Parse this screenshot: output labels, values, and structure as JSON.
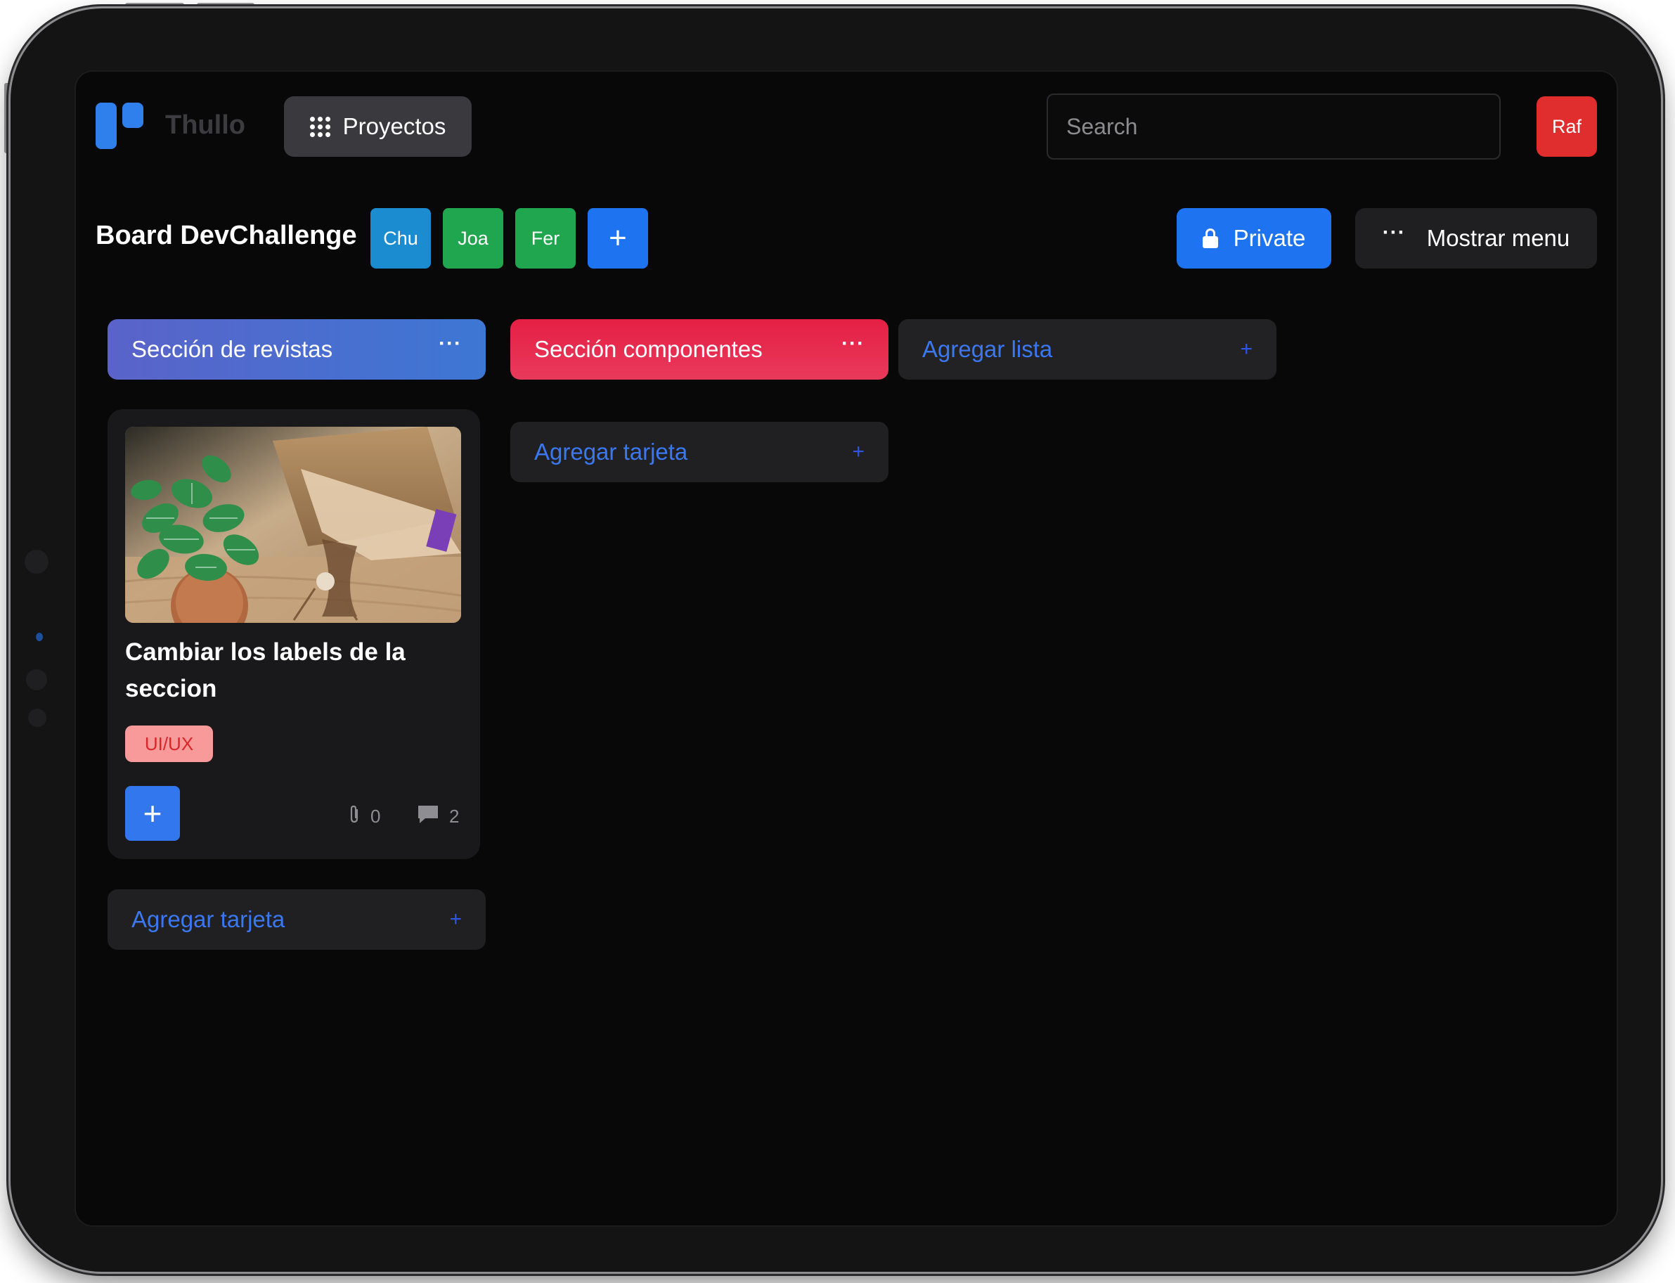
{
  "app": {
    "brand": "Thullo"
  },
  "header": {
    "projects_label": "Proyectos",
    "search_placeholder": "Search",
    "user_avatar": "Raf"
  },
  "board": {
    "title": "Board DevChallenge",
    "members": [
      {
        "initials": "Chu",
        "color": "#1a8ccf"
      },
      {
        "initials": "Joa",
        "color": "#21a650"
      },
      {
        "initials": "Fer",
        "color": "#21a650"
      }
    ],
    "add_member_icon": "plus-icon",
    "visibility_label": "Private",
    "menu_label": "Mostrar menu"
  },
  "lists": [
    {
      "title": "Sección de revistas",
      "cards": [
        {
          "title": "Cambiar los labels de la seccion",
          "image": "plant-and-coffee-photo",
          "tags": [
            "UI/UX"
          ],
          "attachments": "0",
          "comments": "2"
        }
      ],
      "add_card_label": "Agregar tarjeta"
    },
    {
      "title": "Sección componentes",
      "cards": [],
      "add_card_label": "Agregar tarjeta"
    }
  ],
  "add_list_label": "Agregar lista",
  "colors": {
    "accent_blue": "#1e73f0",
    "avatar_red": "#e02d2d",
    "section_red": "#e51f44",
    "section_blue": "#4f6bd0",
    "tag_bg": "#f89a9a",
    "tag_text": "#d8262a"
  }
}
